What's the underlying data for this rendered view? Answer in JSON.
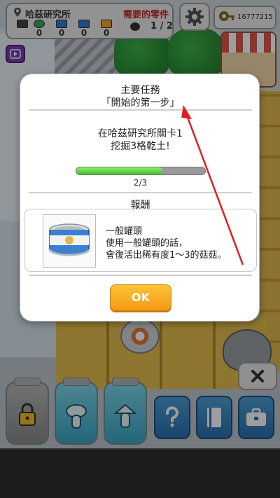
{
  "hud": {
    "location": "哈茲研究所",
    "required_parts_label": "需要的零件",
    "parts_progress": "1 / 2",
    "items": [
      {
        "icon": "green-gem-icon",
        "count": "0",
        "color": "#3aa55a"
      },
      {
        "icon": "blue-crate-icon",
        "count": "0",
        "color": "#2e7fd6"
      },
      {
        "icon": "blue-box-icon",
        "count": "0",
        "color": "#2e7fd6"
      },
      {
        "icon": "orange-box-icon",
        "count": "0",
        "color": "#f2a324"
      }
    ],
    "coins": "16777215"
  },
  "mission": {
    "title": "主要任務",
    "subtitle": "「開始的第一步」",
    "desc_line1": "在哈茲研究所關卡1",
    "desc_line2": "挖掘3格乾土!",
    "progress_text": "2/3",
    "progress_fraction": 0.667,
    "reward_header": "報酬",
    "reward_name": "一般罐頭",
    "reward_desc_line1": "使用一般罐頭的話，",
    "reward_desc_line2": "會復活出稀有度1～3的菇菇。",
    "ok_label": "OK"
  },
  "colors": {
    "accent": "#f29a12",
    "progress": "#4fcf2a",
    "required_parts": "#c62a2a",
    "annotation": "#e02020"
  }
}
